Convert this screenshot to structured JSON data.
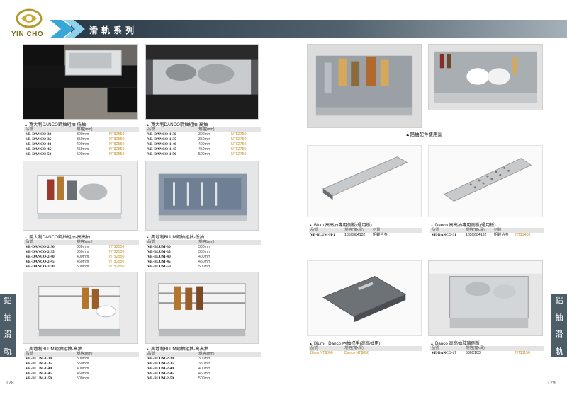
{
  "brand": {
    "name": "YIN CHO",
    "logo_icon": "yin-cho-logo"
  },
  "header": {
    "title": "滑軌系列"
  },
  "side_tab": {
    "left_text": [
      "鋁",
      "抽",
      "滑",
      "軌"
    ],
    "right_text": [
      "鋁",
      "抽",
      "滑",
      "軌"
    ]
  },
  "pages": {
    "left": "128",
    "right": "129"
  },
  "colors": {
    "header_dark": "#2a3a46",
    "accent_blue": "#3aa6d8",
    "price_gold": "#c9902a",
    "side_tab": "#4d5d68"
  },
  "products": [
    {
      "caption": "寬大利DANCO鋼抽組抽-低抽",
      "header": [
        "品號",
        "規格(mm)",
        ""
      ],
      "rows": [
        [
          "VE-DANCO-30",
          "300mm",
          "NT$2550"
        ],
        [
          "VE-DANCO-35",
          "350mm",
          "NT$2550"
        ],
        [
          "VE-DANCO-40",
          "400mm",
          "NT$2550"
        ],
        [
          "VE-DANCO-45",
          "450mm",
          "NT$2550"
        ],
        [
          "VE-DANCO-50",
          "500mm",
          "NT$2550"
        ]
      ]
    },
    {
      "caption": "寬大利DANCO鋼抽組抽-高抽",
      "header": [
        "品號",
        "規格(mm)",
        ""
      ],
      "rows": [
        [
          "VE-DANCO-1-30",
          "300mm",
          "NT$2750"
        ],
        [
          "VE-DANCO-1-35",
          "350mm",
          "NT$2750"
        ],
        [
          "VE-DANCO-1-40",
          "400mm",
          "NT$2750"
        ],
        [
          "VE-DANCO-1-45",
          "450mm",
          "NT$2750"
        ],
        [
          "VE-DANCO-1-50",
          "500mm",
          "NT$2750"
        ]
      ]
    },
    {
      "caption": "義大利DANCO鋼抽組抽-高高抽",
      "header": [
        "品號",
        "規格(mm)",
        ""
      ],
      "rows": [
        [
          "VE-DANCO-2-30",
          "300mm",
          "NT$2550"
        ],
        [
          "VE-DANCO-2-35",
          "350mm",
          "NT$2550"
        ],
        [
          "VE-DANCO-2-40",
          "400mm",
          "NT$2550"
        ],
        [
          "VE-DANCO-2-45",
          "450mm",
          "NT$2550"
        ],
        [
          "VE-DANCO-2-50",
          "500mm",
          "NT$2550"
        ]
      ]
    },
    {
      "caption": "奧地利BLUM鋼抽組抽-低抽",
      "header": [
        "品號",
        "規格(mm)",
        ""
      ],
      "rows": [
        [
          "VE-BLUM-30",
          "300mm",
          ""
        ],
        [
          "VE-BLUM-35",
          "350mm",
          ""
        ],
        [
          "VE-BLUM-40",
          "400mm",
          ""
        ],
        [
          "VE-BLUM-45",
          "450mm",
          ""
        ],
        [
          "VE-BLUM-50",
          "500mm",
          ""
        ]
      ]
    },
    {
      "caption": "奧地利BLUM鋼抽組抽-高抽",
      "header": [
        "品號",
        "規格(mm)",
        ""
      ],
      "rows": [
        [
          "VE-BLUM-1-30",
          "300mm",
          ""
        ],
        [
          "VE-BLUM-1-35",
          "350mm",
          ""
        ],
        [
          "VE-BLUM-1-40",
          "400mm",
          ""
        ],
        [
          "VE-BLUM-1-45",
          "450mm",
          ""
        ],
        [
          "VE-BLUM-1-50",
          "500mm",
          ""
        ]
      ]
    },
    {
      "caption": "奧地利BLUM鋼抽組抽-高高抽",
      "header": [
        "品號",
        "規格(mm)",
        ""
      ],
      "rows": [
        [
          "VE-BLUM-2-30",
          "300mm",
          ""
        ],
        [
          "VE-BLUM-2-35",
          "350mm",
          ""
        ],
        [
          "VE-BLUM-2-40",
          "400mm",
          ""
        ],
        [
          "VE-BLUM-2-45",
          "450mm",
          ""
        ],
        [
          "VE-BLUM-2-50",
          "500mm",
          ""
        ]
      ]
    }
  ],
  "fittings_caption": "▲鋁抽配件使用圖",
  "accessories": [
    {
      "caption": "Blum 高高抽專用側板(通用板)",
      "header": [
        "品號",
        "規格(寬x深)",
        "材質",
        ""
      ],
      "row": [
        "VE-BLUM-H-1",
        "165X684132",
        "鋁鎂合金",
        ""
      ]
    },
    {
      "caption": "Danco 高高抽專用側板(通用板)",
      "header": [
        "品號",
        "規格(寬x深)",
        "材質",
        ""
      ],
      "row": [
        "VE-DANCO-31",
        "165X684132",
        "鋁鎂合金",
        "NT$1450"
      ]
    },
    {
      "caption": "Blum、Danco 內抽把手(高高抽用)",
      "header": [
        "品號",
        "規格(寬x深)"
      ],
      "row": [
        "Blum NT$800",
        "Danco NT$850"
      ]
    },
    {
      "caption": "Danco 高高抽玻璃側板",
      "header": [
        "品號",
        "規格(寬x深)",
        "",
        ""
      ],
      "row": [
        "VE-DANCO-17",
        "530X163",
        "",
        "NT$1150"
      ]
    }
  ]
}
